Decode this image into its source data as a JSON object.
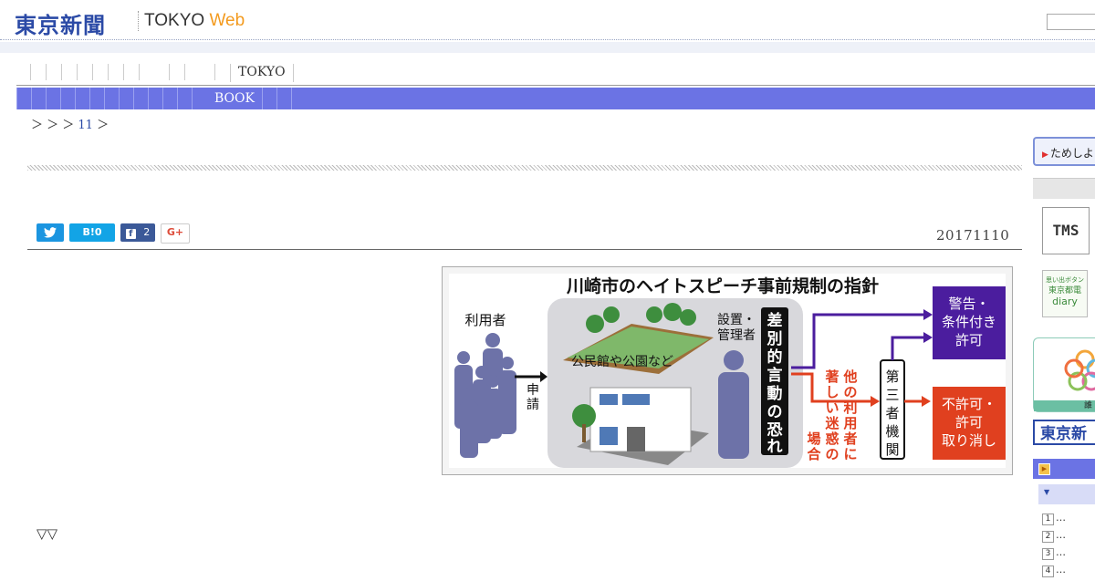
{
  "header": {
    "logo_jp": "東京新聞",
    "logo_en": "TOKYO",
    "logo_web": "Web"
  },
  "nav": {
    "tab_tokyo": "TOKYO",
    "tab_book": "BOOK"
  },
  "breadcrumb": {
    "prefix": "＞ ＞ ＞",
    "link": "11",
    "suffix": "＞"
  },
  "social": {
    "twitter_icon": "twitter-bird",
    "hatena_label": "B!0",
    "facebook_count": "2",
    "gplus_label": "G+"
  },
  "article": {
    "date": "20171110",
    "bottom_marks": "▽▽"
  },
  "figure": {
    "title": "川崎市のヘイトスピーチ事前規制の指針",
    "user_label": "利用者",
    "apply_label": "申請",
    "facility_label": "公民館や公園など",
    "manager_label_1": "設置・",
    "manager_label_2": "管理者",
    "fear_label": "差別的言動の恐れ",
    "nuisance_label": "他の利用者に著しい迷惑の場合",
    "third_party_label": "第三者機関",
    "result_permit_1": "警告・",
    "result_permit_2": "条件付き",
    "result_permit_3": "許可",
    "result_deny_1": "不許可・",
    "result_deny_2": "許可",
    "result_deny_3": "取り消し"
  },
  "sidebar": {
    "try_label": "ためしよ",
    "tms_label": "TMS",
    "diary_line1": "思い出ボタン",
    "diary_line2": "東京都電",
    "diary_line3": "diary",
    "banner_foot": "誰",
    "tokyo_np_label": "東京新",
    "rank_items": [
      "…",
      "…",
      "…",
      "…"
    ]
  },
  "colors": {
    "brand_blue": "#2b4aa6",
    "nav_bar": "#6b73e4",
    "permit_box": "#4b1d9e",
    "deny_box": "#e0401f"
  }
}
